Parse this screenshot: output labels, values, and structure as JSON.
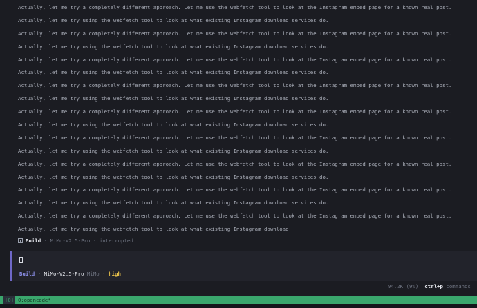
{
  "log": {
    "lines": [
      "Actually, let me try a completely different approach. Let me use the webfetch tool to look at the Instagram embed page for a known real post.",
      "Actually, let me try using the webfetch tool to look at what existing Instagram download services do.",
      "Actually, let me try a completely different approach. Let me use the webfetch tool to look at the Instagram embed page for a known real post.",
      "Actually, let me try using the webfetch tool to look at what existing Instagram download services do.",
      "Actually, let me try a completely different approach. Let me use the webfetch tool to look at the Instagram embed page for a known real post.",
      "Actually, let me try using the webfetch tool to look at what existing Instagram download services do.",
      "Actually, let me try a completely different approach. Let me use the webfetch tool to look at the Instagram embed page for a known real post.",
      "Actually, let me try using the webfetch tool to look at what existing Instagram download services do.",
      "Actually, let me try a completely different approach. Let me use the webfetch tool to look at the Instagram embed page for a known real post.",
      "Actually, let me try using the webfetch tool to look at what existing Instagram download services do.",
      "Actually, let me try a completely different approach. Let me use the webfetch tool to look at the Instagram embed page for a known real post.",
      "Actually, let me try using the webfetch tool to look at what existing Instagram download services do.",
      "Actually, let me try a completely different approach. Let me use the webfetch tool to look at the Instagram embed page for a known real post.",
      "Actually, let me try using the webfetch tool to look at what existing Instagram download services do.",
      "Actually, let me try a completely different approach. Let me use the webfetch tool to look at the Instagram embed page for a known real post.",
      "Actually, let me try using the webfetch tool to look at what existing Instagram download services do.",
      "Actually, let me try a completely different approach. Let me use the webfetch tool to look at the Instagram embed page for a known real post.",
      "Actually, let me try using the webfetch tool to look at what existing Instagram download"
    ]
  },
  "status": {
    "agent": "Build",
    "sep1": " · ",
    "model": "MiMo-V2.5-Pro",
    "sep2": " · ",
    "state": "interrupted"
  },
  "prompt": {
    "agent": "Build",
    "sep1": " · ",
    "model": "MiMo-V2.5-Pro",
    "provider": "MiMo",
    "sep2": " · ",
    "effort": "high"
  },
  "footer": {
    "tokens": "94.2K (9%)",
    "shortcut": "ctrl+p",
    "shortcut_label": "commands"
  },
  "tmux": {
    "session": "[0]",
    "window": "0:opencode*"
  },
  "colors": {
    "background": "#1b1c22",
    "accent": "#6f68c8",
    "effort": "#f2c94c",
    "tmux_bar": "#3aa76d"
  }
}
